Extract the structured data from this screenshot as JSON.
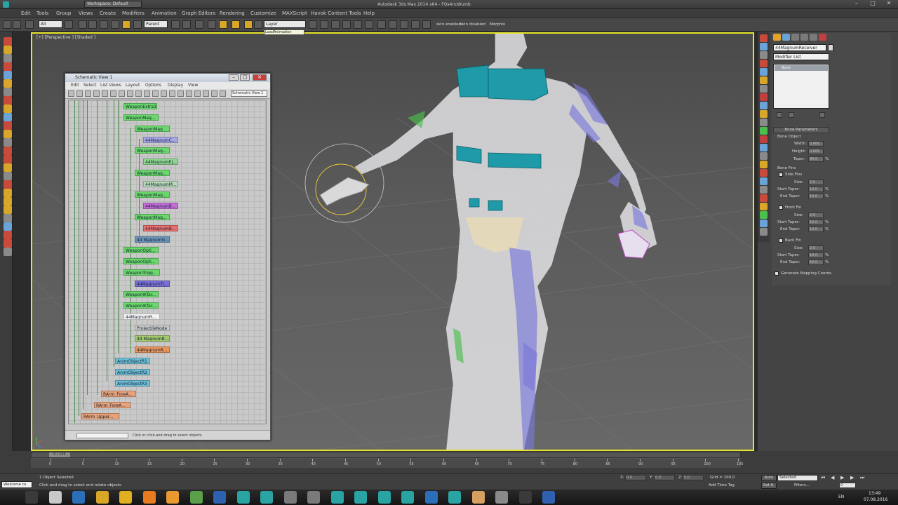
{
  "app": {
    "title": "Autodesk 3ds Max 2014 x64 - FOs4ncWumb",
    "workspace": "Workspace: Default"
  },
  "menu": [
    "Edit",
    "Tools",
    "Group",
    "Views",
    "Create",
    "Modifiers",
    "Animation",
    "Graph Editors",
    "Rendering",
    "Customize",
    "MAXScript",
    "Havok Content Tools",
    "Help"
  ],
  "toolbar": {
    "selection_filter": "All",
    "ref_coord": "Parent",
    "anim_layer": "Layer",
    "tooltip": "LoadAnimation",
    "skin_enabled": "skin enabled",
    "skin_disabled": "skin disabled",
    "morphix": "Morphix"
  },
  "viewport": {
    "label": "[+] [Perspective ] [Shaded ]"
  },
  "schematic": {
    "title": "Schematic View 1",
    "menu": [
      "Edit",
      "Select",
      "List Views",
      "Layout",
      "Options",
      "Display",
      "View"
    ],
    "view_name": "Schematic View 1",
    "status": "Click or click-and-drag to select objects",
    "nodes": [
      {
        "label": "WeaponExtra3",
        "color": "#6bd86b"
      },
      {
        "label": "WeaponMag...",
        "color": "#6bd86b"
      },
      {
        "label": "WeaponMag",
        "color": "#6bd86b"
      },
      {
        "label": "44MagnumC...",
        "color": "#a7a7e8"
      },
      {
        "label": "WeaponMag...",
        "color": "#6bd86b"
      },
      {
        "label": "44MagnumEj...",
        "color": "#8fd68f"
      },
      {
        "label": "WeaponMag...",
        "color": "#6bd86b"
      },
      {
        "label": "44MagnumM...",
        "color": "#b9d8b9"
      },
      {
        "label": "WeaponMag...",
        "color": "#6bd86b"
      },
      {
        "label": "44MagnumB...",
        "color": "#c46ed8"
      },
      {
        "label": "WeaponMag...",
        "color": "#6bd86b"
      },
      {
        "label": "44MagnumB...",
        "color": "#e87070"
      },
      {
        "label": "44 MagnumG...",
        "color": "#6a93b9"
      },
      {
        "label": "WeaponOpti...",
        "color": "#6bd86b"
      },
      {
        "label": "WeaponOpti...",
        "color": "#6bd86b"
      },
      {
        "label": "WeaponTrigg...",
        "color": "#6bd86b"
      },
      {
        "label": "44MagnumTr...",
        "color": "#7b6fd8"
      },
      {
        "label": "WeaponIKTar...",
        "color": "#6bd86b"
      },
      {
        "label": "WeaponIKTar...",
        "color": "#6bd86b"
      },
      {
        "label": "44MagnumR...",
        "color": "#f2f2f2"
      },
      {
        "label": "ProjectileNode",
        "color": "#c9c9c9"
      },
      {
        "label": "44 MagnumB...",
        "color": "#a2c86a"
      },
      {
        "label": "44MagnumR...",
        "color": "#e8955a"
      },
      {
        "label": "AnimObjectR1",
        "color": "#6fc0d8"
      },
      {
        "label": "AnimObjectR2",
        "color": "#6fc0d8"
      },
      {
        "label": "AnimObjectR3",
        "color": "#6fc0d8"
      },
      {
        "label": "RArm_ForeA...",
        "color": "#e8a27a"
      },
      {
        "label": "RArm_ForeA...",
        "color": "#e8a27a"
      },
      {
        "label": "RArm_Upper...",
        "color": "#e8a27a"
      }
    ]
  },
  "command_panel": {
    "object_name": "44MagnumReceiver",
    "modifier_list": "Modifier List",
    "stack_item": "Bone",
    "rollout": "Bone Parameters",
    "bone_object": "Bone Object",
    "width_label": "Width:",
    "width_value": "0.666",
    "height_label": "Height:",
    "height_value": "0.666",
    "taper_label": "Taper:",
    "taper_value": "90.0",
    "bone_fins": "Bone Fins",
    "side_fins": "Side Fins",
    "front_fin": "Front Fin",
    "back_fin": "Back Fin",
    "size_label": "Size:",
    "size_value": "2.0",
    "start_taper_label": "Start Taper:",
    "start_taper_value": "10.0",
    "end_taper_label": "End Taper:",
    "end_taper_value": "10.0",
    "pct": "%",
    "generate_mapping": "Generate Mapping Coords."
  },
  "timeline": {
    "frame": "0 / 105",
    "ticks": [
      "0",
      "5",
      "10",
      "15",
      "20",
      "25",
      "30",
      "35",
      "40",
      "45",
      "50",
      "55",
      "60",
      "65",
      "70",
      "75",
      "80",
      "85",
      "90",
      "95",
      "100",
      "105"
    ]
  },
  "status": {
    "welcome": "Welcome to",
    "selected": "1 Object Selected",
    "prompt": "Click and drag to select and rotate objects",
    "x": "0.0",
    "y": "0.0",
    "z": "0.0",
    "grid": "Grid = 100.0",
    "auto": "Auto",
    "set_k": "Set K.",
    "selected_dd": "Selected",
    "filters": "Filters...",
    "add_time_tag": "Add Time Tag",
    "frame_value": "0"
  },
  "taskbar": {
    "lang": "EN",
    "time": "13:49",
    "date": "07.08.2016"
  }
}
